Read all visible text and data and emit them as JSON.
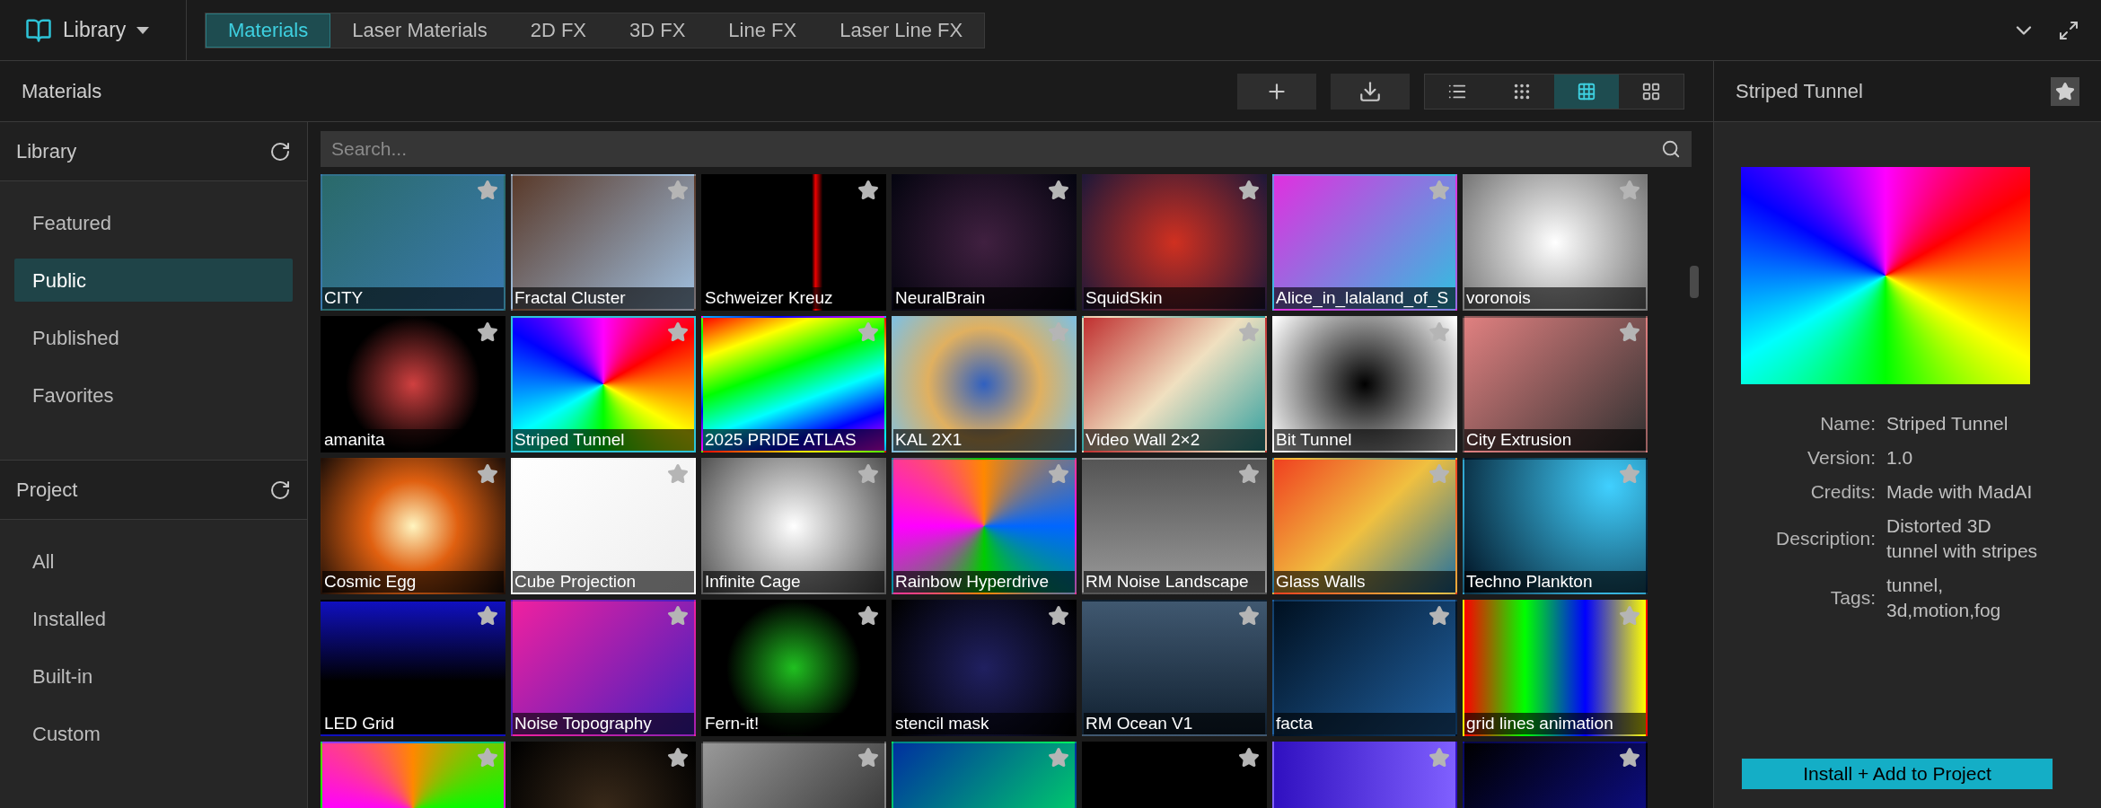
{
  "header": {
    "library_menu": "Library",
    "tabs": [
      {
        "label": "Materials",
        "selected": true
      },
      {
        "label": "Laser Materials",
        "selected": false
      },
      {
        "label": "2D FX",
        "selected": false
      },
      {
        "label": "3D FX",
        "selected": false
      },
      {
        "label": "Line FX",
        "selected": false
      },
      {
        "label": "Laser Line FX",
        "selected": false
      }
    ]
  },
  "toolbar": {
    "title": "Materials",
    "view_modes": [
      {
        "kind": "list",
        "selected": false
      },
      {
        "kind": "small",
        "selected": false
      },
      {
        "kind": "medium",
        "selected": true
      },
      {
        "kind": "large",
        "selected": false
      }
    ]
  },
  "sidebar": {
    "sections": [
      {
        "title": "Library",
        "items": [
          {
            "label": "Featured",
            "selected": false
          },
          {
            "label": "Public",
            "selected": true
          },
          {
            "label": "Published",
            "selected": false
          },
          {
            "label": "Favorites",
            "selected": false
          }
        ]
      },
      {
        "title": "Project",
        "items": [
          {
            "label": "All",
            "selected": false
          },
          {
            "label": "Installed",
            "selected": false
          },
          {
            "label": "Built-in",
            "selected": false
          },
          {
            "label": "Custom",
            "selected": false
          }
        ]
      }
    ]
  },
  "search": {
    "placeholder": "Search..."
  },
  "materials": [
    {
      "title": "CITY",
      "selected": false
    },
    {
      "title": "Fractal Cluster",
      "selected": false
    },
    {
      "title": "Schweizer Kreuz",
      "selected": false
    },
    {
      "title": "NeuralBrain",
      "selected": false
    },
    {
      "title": "SquidSkin",
      "selected": false
    },
    {
      "title": "Alice_in_lalaland_of_S",
      "selected": false
    },
    {
      "title": "voronois",
      "selected": false
    },
    {
      "title": "amanita",
      "selected": false
    },
    {
      "title": "Striped Tunnel",
      "selected": true
    },
    {
      "title": "2025 PRIDE ATLAS",
      "selected": false
    },
    {
      "title": "KAL 2X1",
      "selected": false
    },
    {
      "title": "Video Wall 2×2",
      "selected": false
    },
    {
      "title": "Bit Tunnel",
      "selected": false
    },
    {
      "title": "City Extrusion",
      "selected": false
    },
    {
      "title": "Cosmic Egg",
      "selected": false
    },
    {
      "title": "Cube Projection",
      "selected": false
    },
    {
      "title": "Infinite Cage",
      "selected": false
    },
    {
      "title": "Rainbow Hyperdrive",
      "selected": false
    },
    {
      "title": "RM Noise Landscape",
      "selected": false
    },
    {
      "title": "Glass Walls",
      "selected": false
    },
    {
      "title": "Techno Plankton",
      "selected": false
    },
    {
      "title": "LED Grid",
      "selected": false
    },
    {
      "title": "Noise Topography",
      "selected": false
    },
    {
      "title": "Fern-it!",
      "selected": false
    },
    {
      "title": "stencil mask",
      "selected": false
    },
    {
      "title": "RM Ocean V1",
      "selected": false
    },
    {
      "title": "facta",
      "selected": false
    },
    {
      "title": "grid lines animation",
      "selected": false
    },
    {
      "selected": false
    },
    {
      "selected": false
    },
    {
      "selected": false
    },
    {
      "selected": false
    },
    {
      "selected": false
    },
    {
      "selected": false
    },
    {
      "selected": false
    }
  ],
  "details": {
    "title": "Striped Tunnel",
    "fields": [
      {
        "label": "Name:",
        "value": "Striped Tunnel"
      },
      {
        "label": "Version:",
        "value": "1.0"
      },
      {
        "label": "Credits:",
        "value": "Made with MadAI"
      },
      {
        "label": "Description:",
        "value": "Distorted 3D tunnel with stripes"
      },
      {
        "label": "Tags:",
        "value": "tunnel, 3d,motion,fog"
      }
    ],
    "install_button": "Install + Add to Project"
  }
}
